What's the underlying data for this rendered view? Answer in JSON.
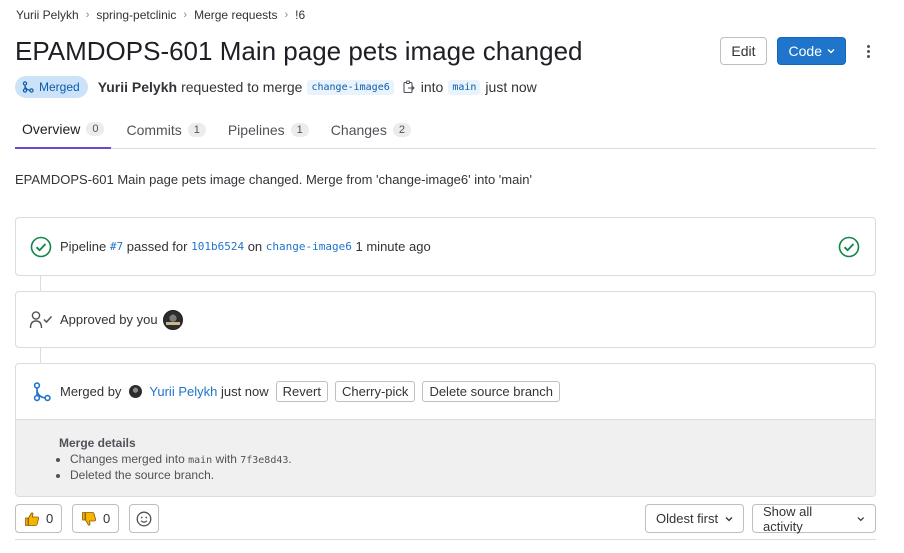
{
  "breadcrumb": [
    "Yurii Pelykh",
    "spring-petclinic",
    "Merge requests",
    "!6"
  ],
  "title": "EPAMDOPS-601 Main page pets image changed",
  "header": {
    "edit_label": "Edit",
    "code_label": "Code"
  },
  "meta": {
    "status_badge": "Merged",
    "author": "Yurii Pelykh",
    "requested_text": "requested to merge",
    "source_branch": "change-image6",
    "into_text": "into",
    "target_branch": "main",
    "time_text": "just now"
  },
  "tabs": [
    {
      "label": "Overview",
      "count": "0"
    },
    {
      "label": "Commits",
      "count": "1"
    },
    {
      "label": "Pipelines",
      "count": "1"
    },
    {
      "label": "Changes",
      "count": "2"
    }
  ],
  "description": "EPAMDOPS-601 Main page pets image changed. Merge from 'change-image6' into 'main'",
  "pipeline": {
    "prefix": "Pipeline",
    "id": "#7",
    "passed_for": "passed for",
    "commit": "101b6524",
    "on": "on",
    "branch": "change-image6",
    "time": "1 minute ago"
  },
  "approval": {
    "text": "Approved by you"
  },
  "merged": {
    "merged_by": "Merged by",
    "user": "Yurii Pelykh",
    "time": "just now",
    "revert_label": "Revert",
    "cherry_pick_label": "Cherry-pick",
    "delete_branch_label": "Delete source branch",
    "details_title": "Merge details",
    "detail_1_prefix": "Changes merged into",
    "detail_1_branch": "main",
    "detail_1_with": "with",
    "detail_1_commit": "7f3e8d43",
    "detail_1_end": ".",
    "detail_2": "Deleted the source branch."
  },
  "reactions": {
    "thumbs_up": "0",
    "thumbs_down": "0"
  },
  "sort": {
    "order_label": "Oldest first",
    "filter_label": "Show all activity"
  },
  "colors": {
    "accent": "#1f75cb",
    "success": "#108548",
    "merged_badge": "#cbe2f9",
    "active_tab": "#6e49cb"
  },
  "icons": [
    "merge-icon",
    "copy-icon",
    "chevron-down-icon",
    "kebab-icon",
    "check-circle-icon",
    "approval-icon",
    "thumbs-up-icon",
    "thumbs-down-icon",
    "smile-icon"
  ]
}
